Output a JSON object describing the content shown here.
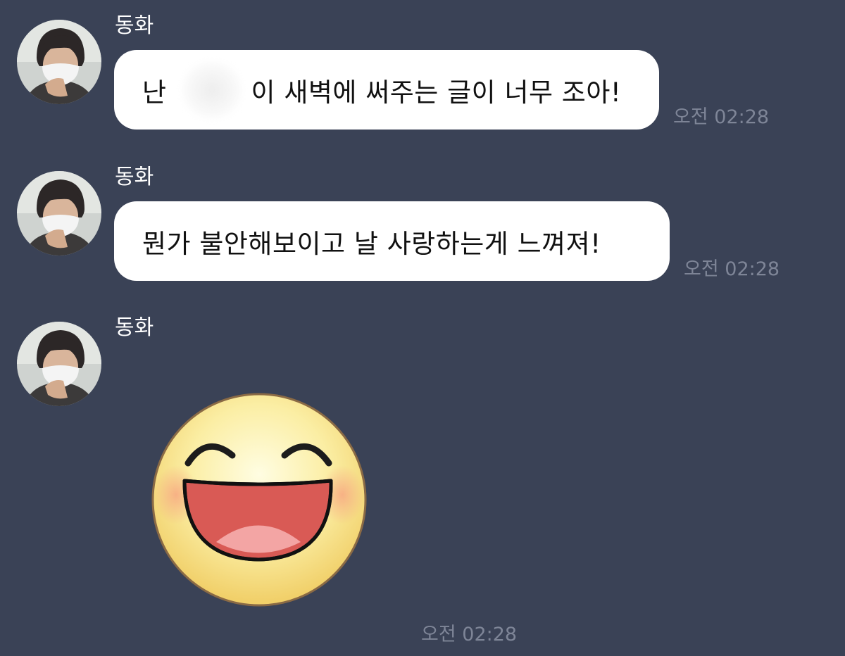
{
  "messages": [
    {
      "sender": "동화",
      "avatar_icon": "profile-photo",
      "text_before": "난",
      "text_after": "이 새벽에 써주는 글이 너무 조아!",
      "time": "오전 02:28"
    },
    {
      "sender": "동화",
      "avatar_icon": "profile-photo",
      "text": "뭔가 불안해보이고 날 사랑하는게 느껴져!",
      "time": "오전 02:28"
    },
    {
      "sender": "동화",
      "avatar_icon": "profile-photo",
      "sticker": "laughing-face-emoticon",
      "time": "오전 02:28"
    }
  ],
  "colors": {
    "background": "#3a4256",
    "bubble": "#ffffff",
    "timestamp": "#7e8597",
    "sender": "#ffffff"
  }
}
